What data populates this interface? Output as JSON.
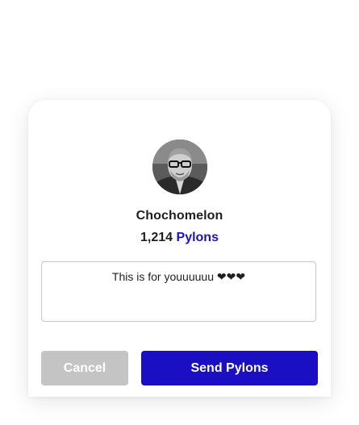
{
  "recipient": {
    "name": "Chochomelon",
    "pylon_balance": "1,214",
    "currency_label": "Pylons"
  },
  "message": {
    "value": "This is for youuuuuu ❤❤❤"
  },
  "actions": {
    "cancel_label": "Cancel",
    "send_label": "Send Pylons"
  },
  "colors": {
    "accent": "#1a0fc2",
    "cancel_bg": "#c4c4c4",
    "text": "#1f1f1f"
  }
}
